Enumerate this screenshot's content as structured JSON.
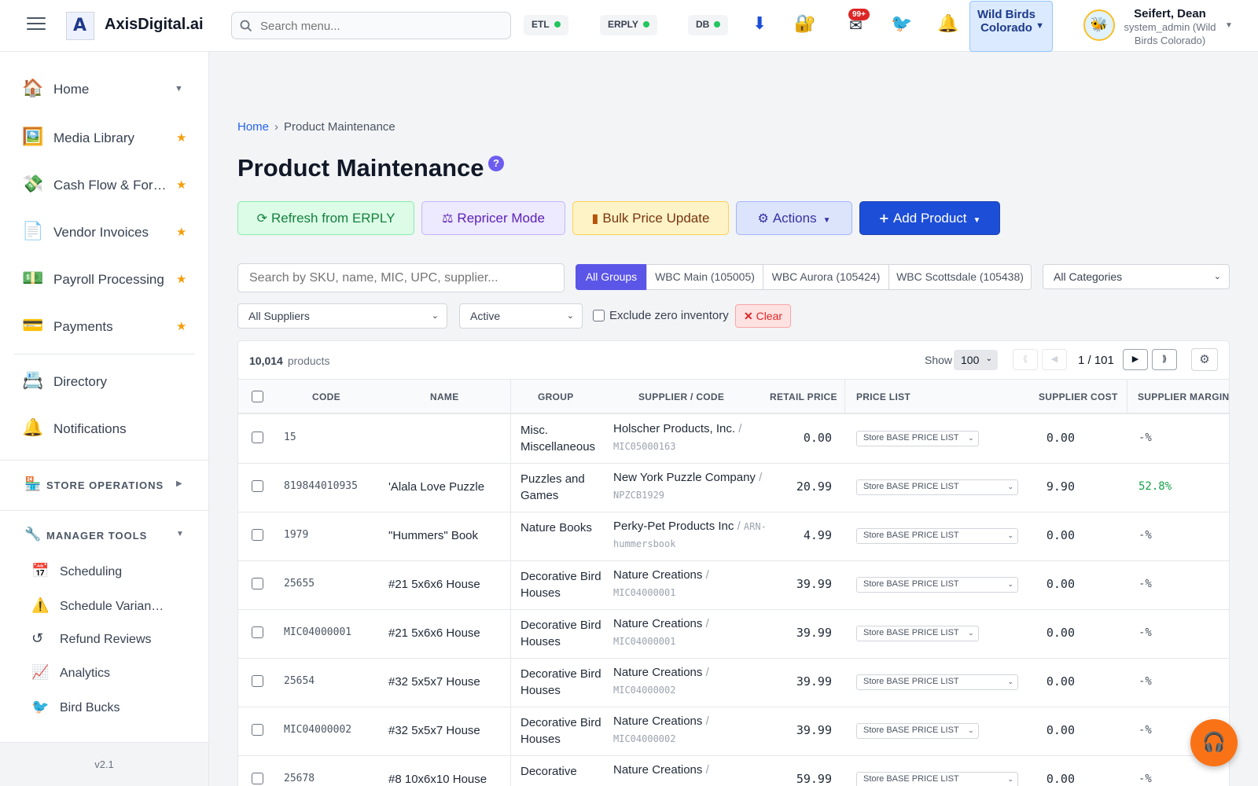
{
  "header": {
    "brand": "AxisDigital.ai",
    "search_placeholder": "Search menu...",
    "status_pills": [
      {
        "label": "ETL",
        "status_color": "#22c55e"
      },
      {
        "label": "ERPLY",
        "status_color": "#22c55e"
      },
      {
        "label": "DB",
        "status_color": "#22c55e"
      }
    ],
    "notification_badge": "99+",
    "store": "Wild Birds Colorado",
    "user_name": "Seifert, Dean",
    "user_role": "system_admin (Wild Birds Colorado)"
  },
  "sidebar": {
    "items": [
      {
        "label": "Home",
        "icon": "house-icon",
        "trailing": "chevron"
      },
      {
        "label": "Media Library",
        "icon": "picture-icon",
        "trailing": "star"
      },
      {
        "label": "Cash Flow & For…",
        "icon": "money-wings-icon",
        "trailing": "star"
      },
      {
        "label": "Vendor Invoices",
        "icon": "document-icon",
        "trailing": "star"
      },
      {
        "label": "Payroll Processing",
        "icon": "dollar-bill-icon",
        "trailing": "star"
      },
      {
        "label": "Payments",
        "icon": "credit-card-icon",
        "trailing": "star"
      },
      {
        "label": "Directory",
        "icon": "rolodex-icon",
        "trailing": ""
      },
      {
        "label": "Notifications",
        "icon": "bell-icon",
        "trailing": ""
      }
    ],
    "sections": [
      {
        "label": "STORE OPERATIONS",
        "icon": "store-icon",
        "state": "collapsed"
      },
      {
        "label": "MANAGER TOOLS",
        "icon": "wrench-icon",
        "state": "expanded"
      }
    ],
    "manager_tools": [
      {
        "label": "Scheduling",
        "icon": "calendar-icon"
      },
      {
        "label": "Schedule Varian…",
        "icon": "warning-icon"
      },
      {
        "label": "Refund Reviews",
        "icon": "undo-icon"
      },
      {
        "label": "Analytics",
        "icon": "chart-icon"
      },
      {
        "label": "Bird Bucks",
        "icon": "bird-icon"
      }
    ],
    "version": "v2.1"
  },
  "page": {
    "breadcrumb_home": "Home",
    "breadcrumb_current": "Product Maintenance",
    "title": "Product Maintenance",
    "help": "?",
    "actions": {
      "refresh": "Refresh from ERPLY",
      "repricer": "Repricer Mode",
      "bulk": "Bulk Price Update",
      "actions": "Actions",
      "add": "Add Product"
    },
    "filters": {
      "search_placeholder": "Search by SKU, name, MIC, UPC, supplier...",
      "groups": [
        "All Groups",
        "WBC Main (105005)",
        "WBC Aurora (105424)",
        "WBC Scottsdale (105438)"
      ],
      "active_group": "All Groups",
      "category": "All Categories",
      "supplier": "All Suppliers",
      "status": "Active",
      "exclude_zero_label": "Exclude zero inventory",
      "exclude_zero_checked": false,
      "clear": "Clear"
    }
  },
  "table": {
    "count": "10,014",
    "count_word": "products",
    "show_label": "Show",
    "page_size": "100",
    "page_info": "1 / 101",
    "columns": [
      "CODE",
      "NAME",
      "GROUP",
      "SUPPLIER / CODE",
      "RETAIL PRICE",
      "PRICE LIST",
      "SUPPLIER COST",
      "SUPPLIER MARGIN"
    ],
    "rows": [
      {
        "code": "15",
        "name": "",
        "group": "Misc. Miscellaneous",
        "supplier": "Holscher Products, Inc.",
        "supplier_code": "MIC05000163",
        "retail": "0.00",
        "price_list": "Store BASE PRICE LIST",
        "cost": "0.00",
        "margin": "-%"
      },
      {
        "code": "819844010935",
        "name": "'Alala Love Puzzle",
        "group": "Puzzles and Games",
        "supplier": "New York Puzzle Company",
        "supplier_code": "NPZCB1929",
        "retail": "20.99",
        "price_list": "Store BASE PRICE LIST",
        "cost": "9.90",
        "margin": "52.8%"
      },
      {
        "code": "1979",
        "name": "\"Hummers\" Book",
        "group": "Nature Books",
        "supplier": "Perky-Pet Products Inc",
        "supplier_code": "ARN-hummersbook",
        "retail": "4.99",
        "price_list": "Store BASE PRICE LIST",
        "cost": "0.00",
        "margin": "-%"
      },
      {
        "code": "25655",
        "name": "#21 5x6x6 House",
        "group": "Decorative Bird Houses",
        "supplier": "Nature Creations",
        "supplier_code": "MIC04000001",
        "retail": "39.99",
        "price_list": "Store BASE PRICE LIST",
        "cost": "0.00",
        "margin": "-%"
      },
      {
        "code": "MIC04000001",
        "name": "#21 5x6x6 House",
        "group": "Decorative Bird Houses",
        "supplier": "Nature Creations",
        "supplier_code": "MIC04000001",
        "retail": "39.99",
        "price_list": "Store BASE PRICE LIST",
        "cost": "0.00",
        "margin": "-%"
      },
      {
        "code": "25654",
        "name": "#32 5x5x7 House",
        "group": "Decorative Bird Houses",
        "supplier": "Nature Creations",
        "supplier_code": "MIC04000002",
        "retail": "39.99",
        "price_list": "Store BASE PRICE LIST",
        "cost": "0.00",
        "margin": "-%"
      },
      {
        "code": "MIC04000002",
        "name": "#32 5x5x7 House",
        "group": "Decorative Bird Houses",
        "supplier": "Nature Creations",
        "supplier_code": "MIC04000002",
        "retail": "39.99",
        "price_list": "Store BASE PRICE LIST",
        "cost": "0.00",
        "margin": "-%"
      },
      {
        "code": "25678",
        "name": "#8 10x6x10 House",
        "group": "Decorative",
        "supplier": "Nature Creations",
        "supplier_code": "",
        "retail": "59.99",
        "price_list": "Store BASE PRICE LIST",
        "cost": "0.00",
        "margin": "-%"
      }
    ]
  }
}
